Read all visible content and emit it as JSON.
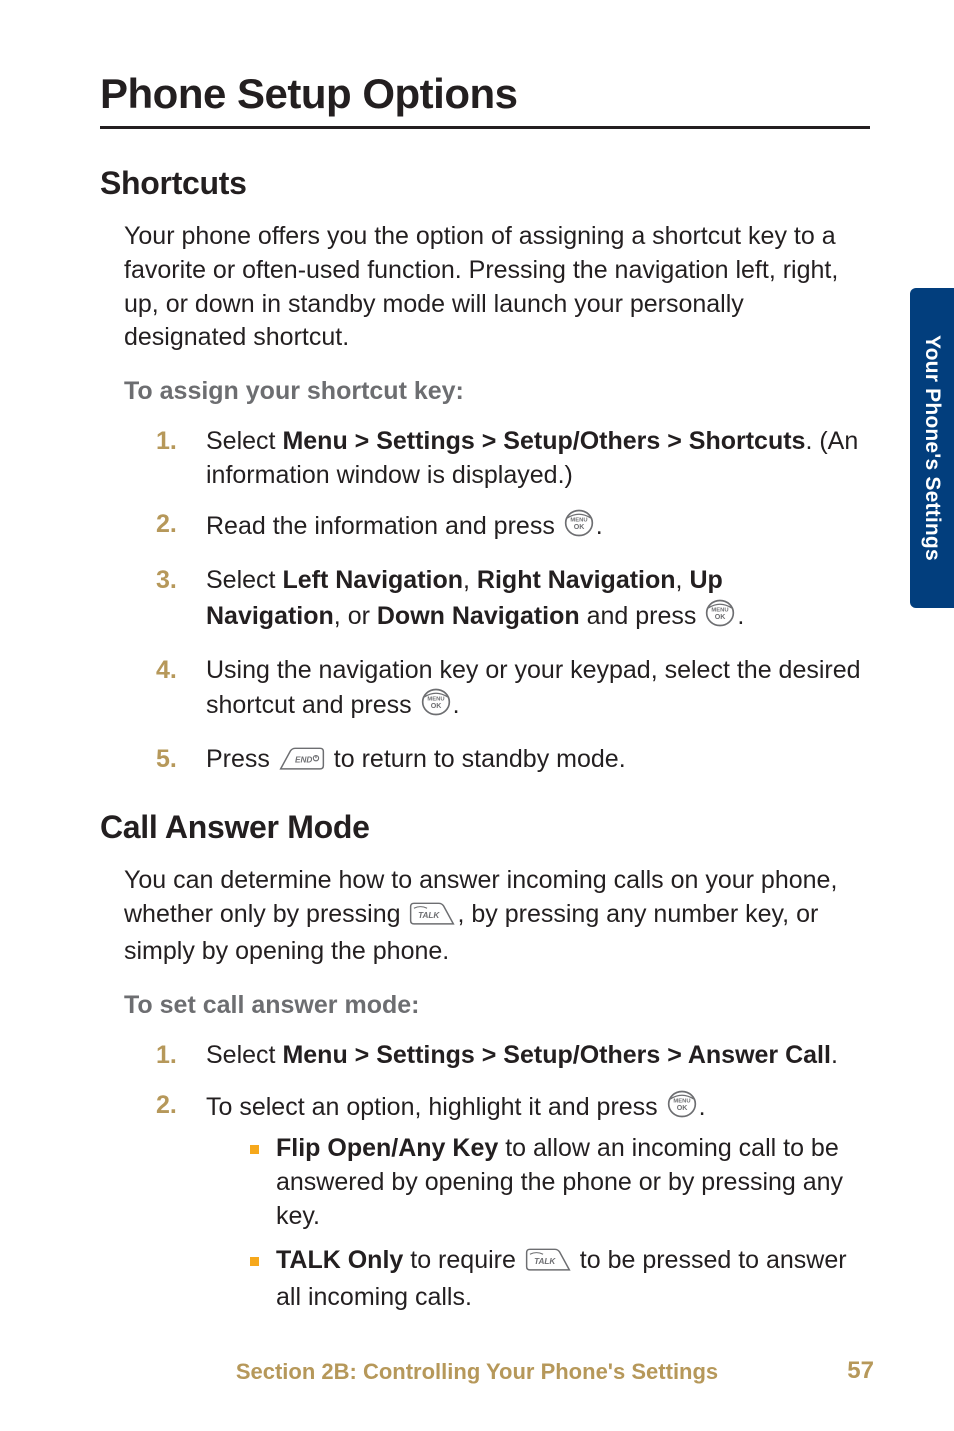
{
  "page_title": "Phone Setup Options",
  "side_tab": "Your Phone's Settings",
  "section1": {
    "heading": "Shortcuts",
    "intro": "Your phone offers you the option of assigning a shortcut key to a favorite or often-used function. Pressing the navigation left, right, up, or down in standby mode will launch your personally designated shortcut.",
    "lead": "To assign your shortcut key:",
    "steps": {
      "s1_a": "Select ",
      "s1_b": "Menu > Settings > Setup/Others > Shortcuts",
      "s1_c": ". (An information window is displayed.)",
      "s2_a": "Read the information and press ",
      "s2_b": ".",
      "s3_a": "Select ",
      "s3_b": "Left Navigation",
      "s3_c": ", ",
      "s3_d": "Right Navigation",
      "s3_e": ", ",
      "s3_f": "Up Navigation",
      "s3_g": ", or ",
      "s3_h": "Down Navigation",
      "s3_i": " and press ",
      "s3_j": ".",
      "s4_a": "Using the navigation key or your keypad, select the desired shortcut and press ",
      "s4_b": ".",
      "s5_a": "Press ",
      "s5_b": " to return to standby mode."
    },
    "numbers": {
      "n1": "1.",
      "n2": "2.",
      "n3": "3.",
      "n4": "4.",
      "n5": "5."
    }
  },
  "section2": {
    "heading": "Call Answer Mode",
    "intro_a": "You can determine how to answer incoming calls on your phone, whether only by pressing ",
    "intro_b": ", by pressing any number key, or simply by opening the phone.",
    "lead": "To set call answer mode:",
    "steps": {
      "s1_a": "Select ",
      "s1_b": "Menu > Settings > Setup/Others > Answer Call",
      "s1_c": ".",
      "s2_a": "To select an option, highlight it and press ",
      "s2_b": "."
    },
    "bullets": {
      "b1_a": "Flip Open/Any Key ",
      "b1_b": "to allow an incoming call to be answered by opening the phone or by pressing any key.",
      "b2_a": "TALK Only ",
      "b2_b": "to require ",
      "b2_c": " to be pressed to answer all incoming calls."
    },
    "numbers": {
      "n1": "1.",
      "n2": "2."
    }
  },
  "footer": {
    "text": "Section 2B: Controlling Your Phone's Settings",
    "page": "57"
  },
  "icons": {
    "menu_ok": "MENU OK",
    "end": "END",
    "talk": "TALK"
  }
}
